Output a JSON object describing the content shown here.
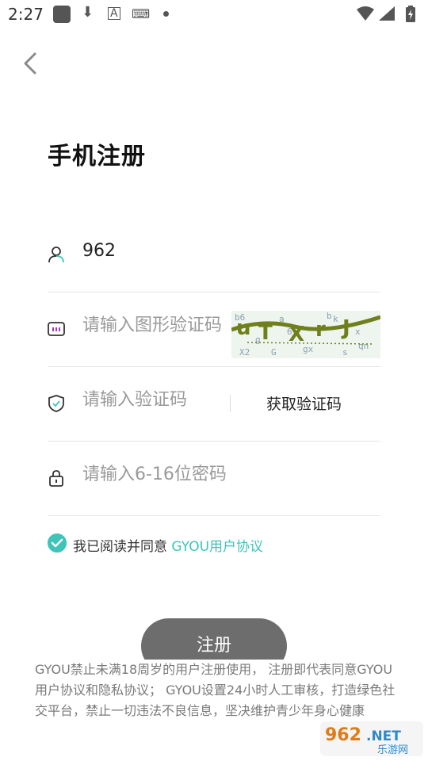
{
  "status_bar": {
    "time": "2:27",
    "icons": [
      "app-icon",
      "download-icon",
      "a-icon",
      "keyboard-icon",
      "dot-icon",
      "wifi-icon",
      "signal-icon",
      "battery-icon"
    ]
  },
  "page": {
    "title": "手机注册"
  },
  "form": {
    "phone": {
      "value": "962",
      "icon": "user-icon"
    },
    "captcha": {
      "placeholder": "请输入图形验证码",
      "icon": "captcha-icon"
    },
    "sms": {
      "placeholder": "请输入验证码",
      "icon": "shield-icon",
      "get_code_label": "获取验证码"
    },
    "password": {
      "placeholder": "请输入6-16位密码",
      "icon": "lock-icon"
    }
  },
  "agreement": {
    "prefix": "我已阅读并同意 ",
    "link": "GYOU用户协议",
    "checked": true
  },
  "register_button": {
    "label": "注册"
  },
  "notice": {
    "text": "GYOU禁止未满18周岁的用户注册使用， 注册即代表同意GYOU用户协议和隐私协议； GYOU设置24小时人工审核，打造绿色社交平台，禁止一切违法不良信息，坚决维护青少年身心健康"
  },
  "watermark": {
    "top": "962.NET",
    "bottom": "乐游网"
  },
  "colors": {
    "accent": "#3ec4b9",
    "button": "#6d6d6d",
    "captcha_ink": "#6f7f1c"
  }
}
